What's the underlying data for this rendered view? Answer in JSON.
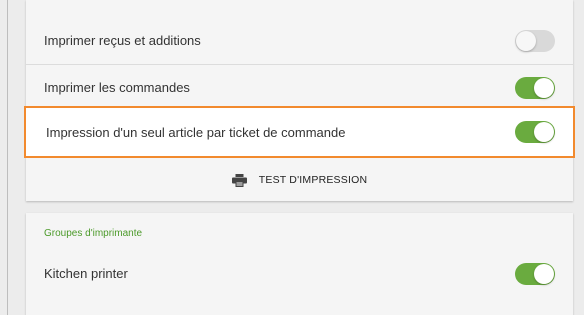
{
  "colors": {
    "accent_green": "#6aab3f",
    "highlight_border": "#f28a2e",
    "section_title": "#4c9a2a"
  },
  "settings": {
    "rows": [
      {
        "label": "Imprimer reçus et additions",
        "toggle": "off"
      },
      {
        "label": "Imprimer les commandes",
        "toggle": "on"
      },
      {
        "label": "Impression d'un seul article par ticket de commande",
        "toggle": "on"
      }
    ],
    "test_print": {
      "label": "TEST D'IMPRESSION",
      "icon": "printer-icon"
    }
  },
  "printer_groups": {
    "title": "Groupes d'imprimante",
    "items": [
      {
        "label": "Kitchen printer",
        "toggle": "on"
      }
    ]
  }
}
